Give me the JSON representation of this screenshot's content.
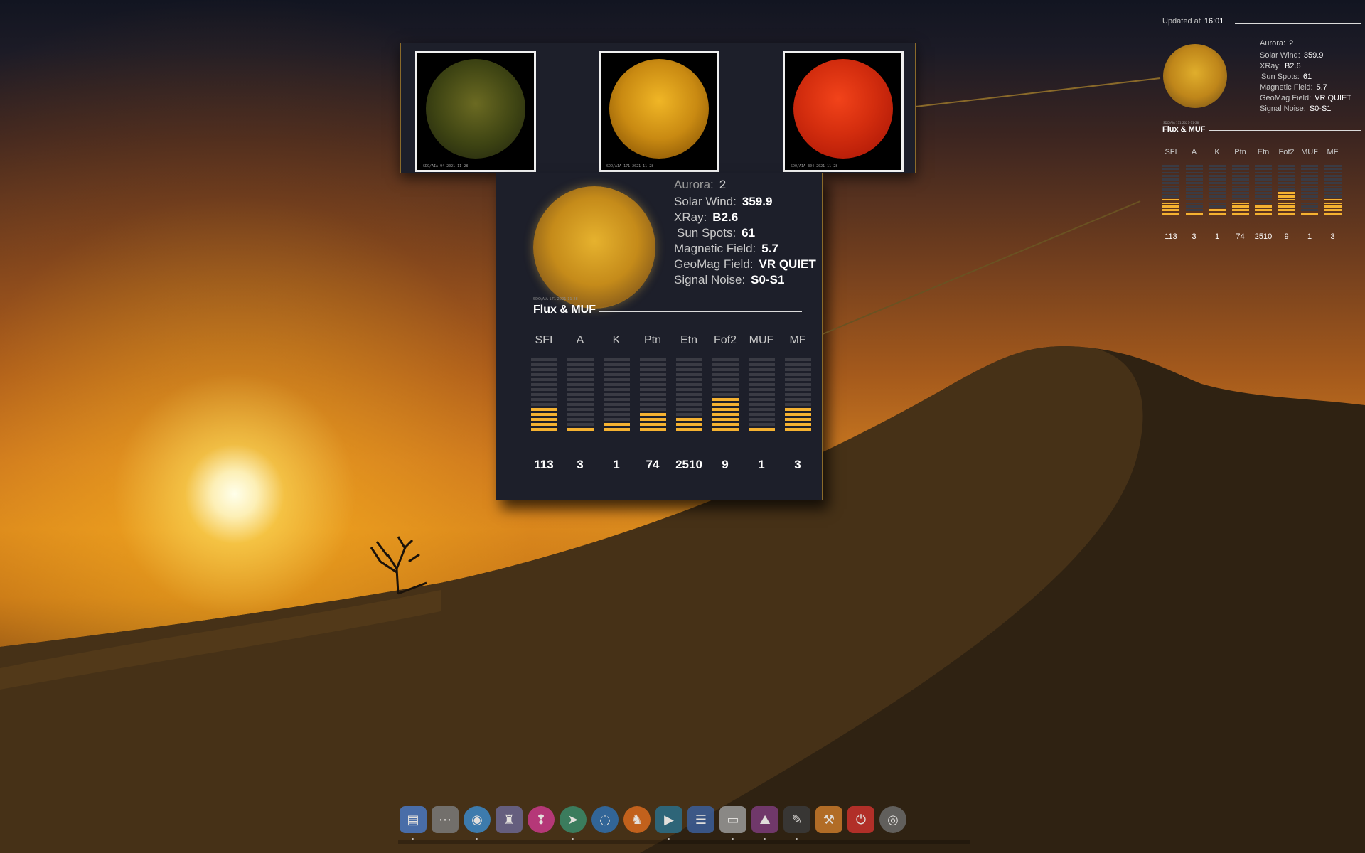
{
  "sun_images": [
    {
      "name": "SDO AIA 94",
      "caption": "SDO/AIA 94 2021-11-28"
    },
    {
      "name": "SDO AIA 171",
      "caption": "SDO/AIA 171 2021-11-28"
    },
    {
      "name": "SDO AIA 304",
      "caption": "SDO/AIA 304 2021-11-28"
    }
  ],
  "conky": {
    "sun_caption": "SDO/AIA 171 2021-11-28",
    "stats": [
      {
        "label": "Aurora:",
        "value": "2"
      },
      {
        "label": "Solar Wind:",
        "value": "359.9"
      },
      {
        "label": "XRay:",
        "value": "B2.6"
      },
      {
        "label": "Sun Spots:",
        "value": "61"
      },
      {
        "label": "Magnetic Field:",
        "value": "5.7"
      },
      {
        "label": "GeoMag Field:",
        "value": "VR QUIET"
      },
      {
        "label": "Signal Noise:",
        "value": "S0-S1"
      }
    ],
    "section_title": "Flux & MUF",
    "columns": [
      {
        "label": "SFI",
        "value": "113",
        "level": 5
      },
      {
        "label": "A",
        "value": "3",
        "level": 1
      },
      {
        "label": "K",
        "value": "1",
        "level": 2
      },
      {
        "label": "Ptn",
        "value": "74",
        "level": 4
      },
      {
        "label": "Etn",
        "value": "2510",
        "level": 3
      },
      {
        "label": "Fof2",
        "value": "9",
        "level": 7
      },
      {
        "label": "MUF",
        "value": "1",
        "level": 1
      },
      {
        "label": "MF",
        "value": "3",
        "level": 5
      }
    ],
    "bar_segments": 15
  },
  "widget": {
    "updated_label": "Updated at",
    "updated_time": "16:01"
  },
  "colors": {
    "accent": "#f5b231",
    "panel": "#1d1f2a",
    "segment_off": "#3a3b44",
    "border": "#8a6a2a"
  },
  "dock": {
    "icons": [
      {
        "name": "file-manager-icon",
        "glyph": "▤",
        "color": "#4a78c2",
        "shape": "rect"
      },
      {
        "name": "network-icon",
        "glyph": "⋯",
        "color": "#7a7a7a",
        "shape": "rect"
      },
      {
        "name": "browser-icon",
        "glyph": "◉",
        "color": "#3c88c8",
        "shape": "round"
      },
      {
        "name": "castle-icon",
        "glyph": "♜",
        "color": "#6b6690",
        "shape": "rect"
      },
      {
        "name": "idea-icon",
        "glyph": "❢",
        "color": "#c93a8a",
        "shape": "round"
      },
      {
        "name": "telegram-icon",
        "glyph": "➤",
        "color": "#3a8a6a",
        "shape": "round"
      },
      {
        "name": "chat-icon",
        "glyph": "◌",
        "color": "#2f6fae",
        "shape": "round"
      },
      {
        "name": "brave-icon",
        "glyph": "♞",
        "color": "#d86a1e",
        "shape": "round"
      },
      {
        "name": "media-player-icon",
        "glyph": "▶",
        "color": "#2a6f8a",
        "shape": "rect"
      },
      {
        "name": "documents-icon",
        "glyph": "☰",
        "color": "#3b5e9a",
        "shape": "rect"
      },
      {
        "name": "screenshot-icon",
        "glyph": "▭",
        "color": "#9a9a9a",
        "shape": "rect"
      },
      {
        "name": "image-viewer-icon",
        "glyph": "⛰",
        "color": "#7c3c7a",
        "shape": "rect"
      },
      {
        "name": "text-editor-icon",
        "glyph": "✎",
        "color": "#3a3a3a",
        "shape": "rect"
      },
      {
        "name": "settings-icon",
        "glyph": "⚒",
        "color": "#c87a2a",
        "shape": "rect"
      },
      {
        "name": "power-icon",
        "glyph": "⏻",
        "color": "#c8322c",
        "shape": "rect"
      },
      {
        "name": "disk-icon",
        "glyph": "◎",
        "color": "#6a6a6a",
        "shape": "round"
      }
    ],
    "running": [
      0,
      2,
      5,
      8,
      10,
      11,
      12
    ]
  }
}
